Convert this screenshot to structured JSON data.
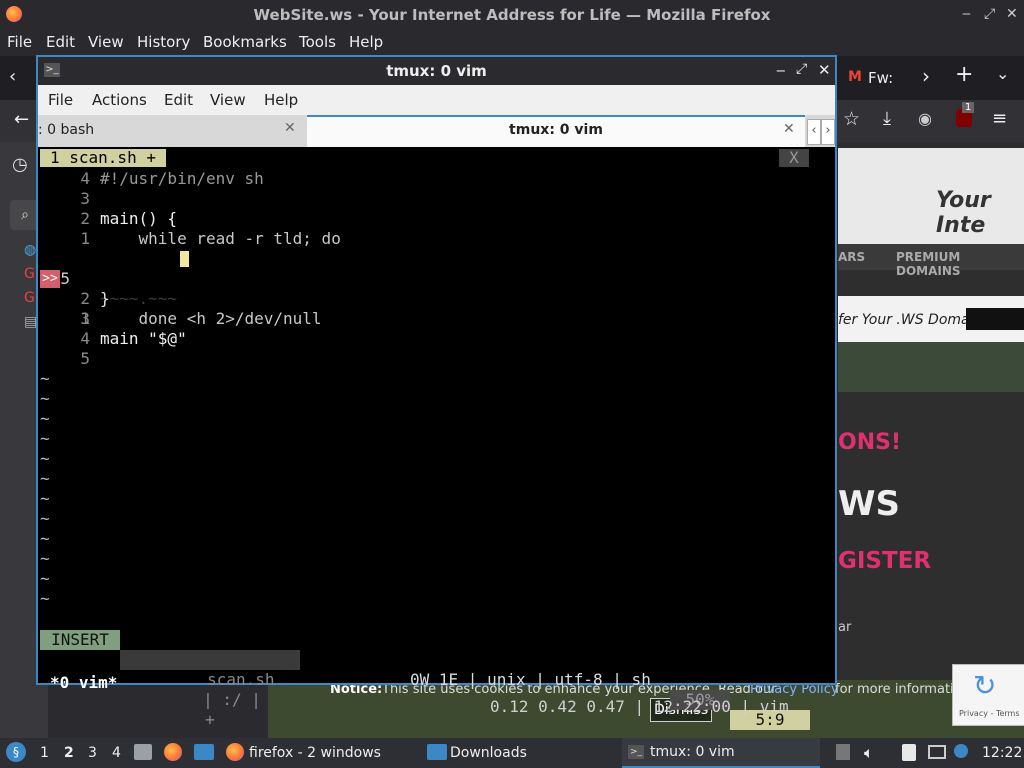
{
  "firefox": {
    "title": "WebSite.ws - Your Internet Address for Life — Mozilla Firefox",
    "menu": [
      "File",
      "Edit",
      "View",
      "History",
      "Bookmarks",
      "Tools",
      "Help"
    ],
    "tab_partial": "Fw:",
    "site": {
      "header_text": "Your Inte",
      "nav_items": [
        "ARS",
        "PREMIUM DOMAINS"
      ],
      "bar_text": "fer Your .WS Domain",
      "promo1": "ONS!",
      "promo2": "WS",
      "promo3": "GISTER",
      "small_text": "ar",
      "notice_label": "Notice:",
      "notice_text": "This site uses cookies to enhance your experience. Read our",
      "privacy_link": "Privacy Policy",
      "notice_tail": "for more informatio",
      "dismiss": "Dismiss",
      "recaptcha": "Privacy - Terms"
    },
    "badge_count": "1"
  },
  "terminal": {
    "title": "tmux: 0 vim",
    "menu": [
      "File",
      "Actions",
      "Edit",
      "View",
      "Help"
    ],
    "tabs": [
      {
        "label": ": 0 bash",
        "active": false
      },
      {
        "label": "tmux: 0 vim",
        "active": true
      }
    ],
    "vim": {
      "buffer_tab": "1 scan.sh +",
      "close": "X",
      "lines": [
        {
          "num": "4",
          "text": "#!/usr/bin/env sh"
        },
        {
          "num": "3",
          "text": ""
        },
        {
          "num": "2",
          "text": "main() {"
        },
        {
          "num": "1",
          "text": "    while read -r tld; do"
        },
        {
          "num": "5",
          "text": "~~~~.~~~"
        },
        {
          "num": "1",
          "text": "    done <h 2>/dev/null"
        },
        {
          "num": "2",
          "text": "}"
        },
        {
          "num": "3",
          "text": ""
        },
        {
          "num": "4",
          "text": "main \"$@\""
        },
        {
          "num": "5",
          "text": ""
        }
      ],
      "sign": ">>",
      "tildes": 12,
      "status": {
        "mode": "INSERT",
        "file": "scan.sh",
        "sep": "| :/ |",
        "plus": "+",
        "info": "0W 1E | unix | utf-8 | sh",
        "percent": "50%",
        "pos": "5:9"
      }
    },
    "tmux": {
      "window": "*0 vim*",
      "right": "0.12 0.42 0.47 | 12:22:00 | vim"
    }
  },
  "taskbar": {
    "workspaces": [
      "1",
      "2",
      "3",
      "4"
    ],
    "active_workspace": "2",
    "firefox": "firefox - 2 windows",
    "downloads": "Downloads",
    "terminal": "tmux: 0 vim",
    "clock": "12:22"
  },
  "colors": {
    "accent": "#3c88c7",
    "vim_mode_bg": "#7f9f7f",
    "vim_pos_bg": "#d0d0a0",
    "error_sign": "#d25f6b"
  }
}
